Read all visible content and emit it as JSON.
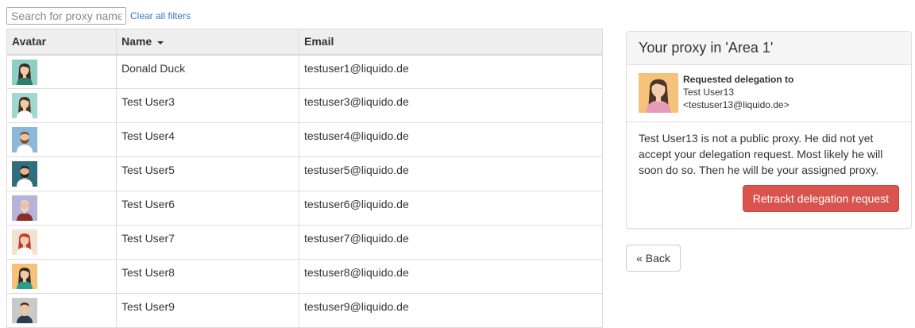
{
  "filter": {
    "search_placeholder": "Search for proxy name",
    "clear_label": "Clear all filters"
  },
  "table": {
    "columns": [
      "Avatar",
      "Name",
      "Email"
    ],
    "rows": [
      {
        "name": "Donald Duck",
        "email": "testuser1@liquido.de",
        "avatar": {
          "bg": "#8ecfc4",
          "hair": "#3a2a22",
          "skin": "#f2c9a8",
          "shirt": "#2e7d6b",
          "long_hair": true,
          "beard": false
        }
      },
      {
        "name": "Test User3",
        "email": "testuser3@liquido.de",
        "avatar": {
          "bg": "#9fd8d0",
          "hair": "#4a3528",
          "skin": "#f2c9a8",
          "shirt": "#ffffff",
          "long_hair": true,
          "beard": false
        }
      },
      {
        "name": "Test User4",
        "email": "testuser4@liquido.de",
        "avatar": {
          "bg": "#8db7d6",
          "hair": "#7a4a2e",
          "skin": "#f0c29d",
          "shirt": "#ffffff",
          "long_hair": false,
          "beard": true
        }
      },
      {
        "name": "Test User5",
        "email": "testuser5@liquido.de",
        "avatar": {
          "bg": "#2f6e7e",
          "hair": "#2a1f1a",
          "skin": "#e8b48e",
          "shirt": "#ffffff",
          "long_hair": false,
          "beard": true
        }
      },
      {
        "name": "Test User6",
        "email": "testuser6@liquido.de",
        "avatar": {
          "bg": "#b7b2d8",
          "hair": "#d8d8d8",
          "skin": "#f0c29d",
          "shirt": "#8a2d2d",
          "long_hair": false,
          "beard": true
        }
      },
      {
        "name": "Test User7",
        "email": "testuser7@liquido.de",
        "avatar": {
          "bg": "#f3e1cf",
          "hair": "#c0392b",
          "skin": "#f4cdb0",
          "shirt": "#ffffff",
          "long_hair": true,
          "beard": false
        }
      },
      {
        "name": "Test User8",
        "email": "testuser8@liquido.de",
        "avatar": {
          "bg": "#f6c27a",
          "hair": "#3a2a22",
          "skin": "#f2c9a8",
          "shirt": "#2e9b8a",
          "long_hair": true,
          "beard": false
        }
      },
      {
        "name": "Test User9",
        "email": "testuser9@liquido.de",
        "avatar": {
          "bg": "#c9c9c9",
          "hair": "#3a2a22",
          "skin": "#f0c29d",
          "shirt": "#2c3e50",
          "long_hair": false,
          "beard": false
        }
      }
    ]
  },
  "panel": {
    "title": "Your proxy in 'Area 1'",
    "delegation_label": "Requested delegation to",
    "delegate_name": "Test User13",
    "delegate_email": "<testuser13@liquido.de>",
    "delegate_avatar": {
      "bg": "#f6c27a",
      "hair": "#4a3528",
      "skin": "#f4cdb0",
      "shirt": "#e89bb5"
    },
    "message": "Test User13 is not a public proxy. He did not yet accept your delegation request. Most likely he will soon do so. Then he will be your assigned proxy.",
    "retract_label": "Retrackt delegation request"
  },
  "back_label": "« Back",
  "colors": {
    "danger": "#d9534f",
    "link": "#337ab7",
    "header_bg": "#eeeeee"
  }
}
